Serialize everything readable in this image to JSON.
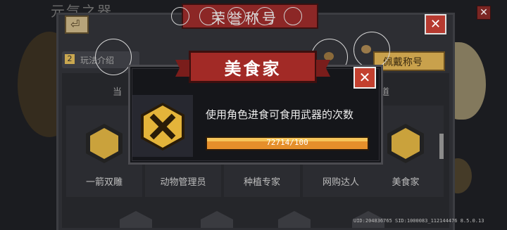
{
  "background_title": "元气之器",
  "back_icon": "back-arrow-icon",
  "header_banner": "荣誉称号",
  "help_label": "玩法介绍",
  "help_badge": "2",
  "equip_button": "佩戴称号",
  "list_header_left": "当",
  "list_header_right": "道",
  "title_cells": [
    {
      "label": "一箭双雕"
    },
    {
      "label": "动物管理员"
    },
    {
      "label": "种植专家"
    },
    {
      "label": "网购达人"
    },
    {
      "label": "美食家"
    }
  ],
  "modal": {
    "title": "美食家",
    "description": "使用角色进食可食用武器的次数",
    "progress_text": "72714/100",
    "progress_fraction": 1.0,
    "close_label": "✕"
  },
  "close_label": "✕",
  "footer": "UID:204836765 SID:1000083_112144476 8.5.0.13",
  "colors": {
    "accent_red": "#a22a26",
    "progress_orange": "#e58f2b",
    "gold": "#e4b43a"
  }
}
